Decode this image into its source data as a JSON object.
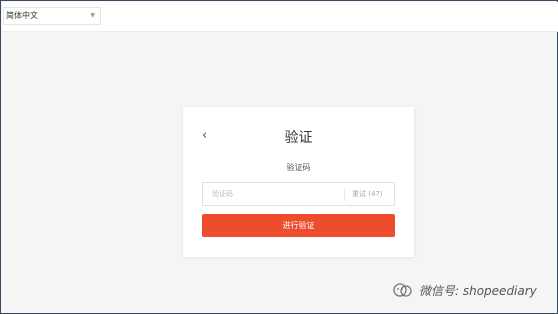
{
  "header": {
    "language_select": {
      "value": "简体中文"
    }
  },
  "card": {
    "title": "验证",
    "subtitle": "验证码",
    "code_input": {
      "placeholder": "验证码",
      "value": ""
    },
    "resend_label": "重试 (47)",
    "submit_label": "进行验证"
  },
  "watermark": {
    "text": "微信号: shopeediary"
  },
  "colors": {
    "accent": "#ee4d2d",
    "border": "#3a4a63",
    "background": "#f5f5f5"
  },
  "icons": {
    "back": "chevron-left-icon",
    "dropdown": "chevron-down-icon",
    "watermark": "wechat-icon"
  }
}
